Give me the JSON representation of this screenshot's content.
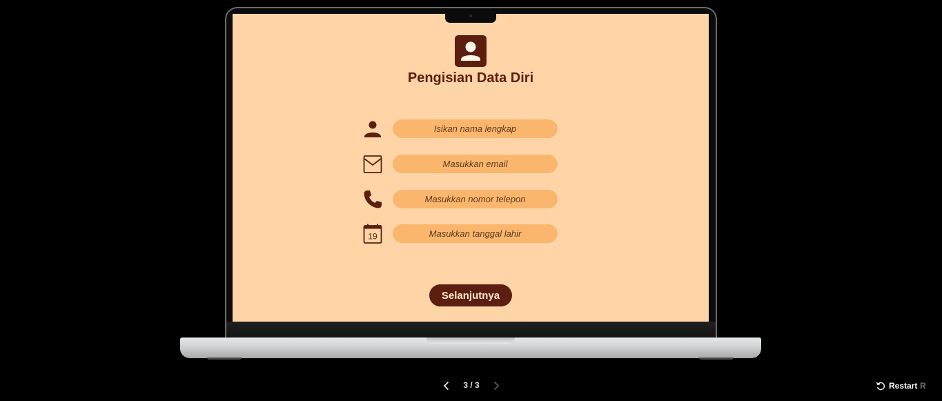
{
  "screen": {
    "title": "Pengisian Data Diri",
    "fields": [
      {
        "icon": "person-icon",
        "placeholder": "Isikan nama lengkap"
      },
      {
        "icon": "mail-icon",
        "placeholder": "Masukkan email"
      },
      {
        "icon": "phone-icon",
        "placeholder": "Masukkan nomor telepon"
      },
      {
        "icon": "calendar-icon",
        "placeholder": "Masukkan tanggal lahir",
        "icon_text": "19"
      }
    ],
    "next_label": "Selanjutnya",
    "colors": {
      "background": "#ffd5a8",
      "accent": "#5c1e0e",
      "field": "#fbb66e"
    }
  },
  "player": {
    "page_indicator": "3 / 3",
    "restart_label": "Restart",
    "restart_shortcut": "R"
  }
}
